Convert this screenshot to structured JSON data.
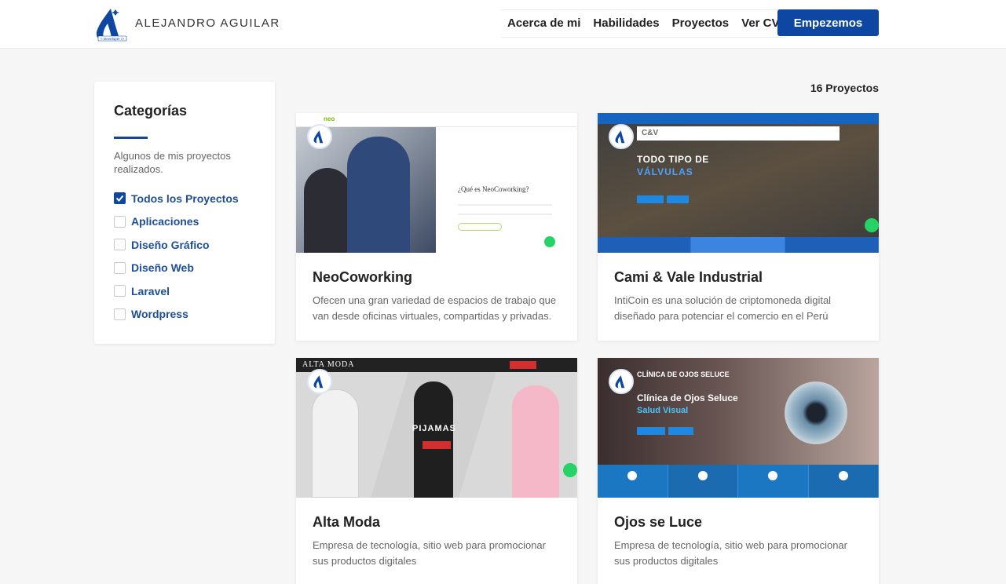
{
  "header": {
    "brand": "ALEJANDRO AGUILAR",
    "nav": [
      "Acerca de mi",
      "Habilidades",
      "Proyectos",
      "Ver CV"
    ],
    "cta": "Empezemos"
  },
  "sidebar": {
    "title": "Categorías",
    "description": "Algunos de mis proyectos realizados.",
    "categories": [
      {
        "label": "Todos los Proyectos",
        "checked": true
      },
      {
        "label": "Aplicaciones",
        "checked": false
      },
      {
        "label": "Diseño Gráfico",
        "checked": false
      },
      {
        "label": "Diseño Web",
        "checked": false
      },
      {
        "label": "Laravel",
        "checked": false
      },
      {
        "label": "Wordpress",
        "checked": false
      }
    ]
  },
  "project_count": "16 Proyectos",
  "projects": [
    {
      "title": "NeoCoworking",
      "description": "Ofecen una gran variedad de espacios de trabajo que van desde oficinas virtuales, compartidas y privadas.",
      "thumb": {
        "logo": "neo",
        "heading": "¿Qué es NeoCoworking?"
      }
    },
    {
      "title": "Cami & Vale Industrial",
      "description": "IntiCoin es una solución de criptomoneda digital diseñado para potenciar el comercio en el Perú",
      "thumb": {
        "logo": "C&V",
        "heading": "TODO TIPO DE",
        "subheading": "VÁLVULAS"
      }
    },
    {
      "title": "Alta Moda",
      "description": "Empresa de tecnología, sitio web para promocionar sus productos digitales",
      "thumb": {
        "logo": "ALTA MODA",
        "heading": "PIJAMAS"
      }
    },
    {
      "title": "Ojos se Luce",
      "description": "Empresa de tecnología, sitio web para promocionar sus productos digitales",
      "thumb": {
        "logo": "CLÍNICA DE OJOS SELUCE",
        "heading": "Clínica de Ojos Seluce",
        "subheading": "Salud Visual"
      }
    }
  ],
  "colors": {
    "accent": "#0e47a1",
    "category_text": "#1d4f95"
  },
  "icons": {
    "logo": "developer-logo-icon",
    "check": "check-icon",
    "whatsapp": "whatsapp-icon"
  }
}
